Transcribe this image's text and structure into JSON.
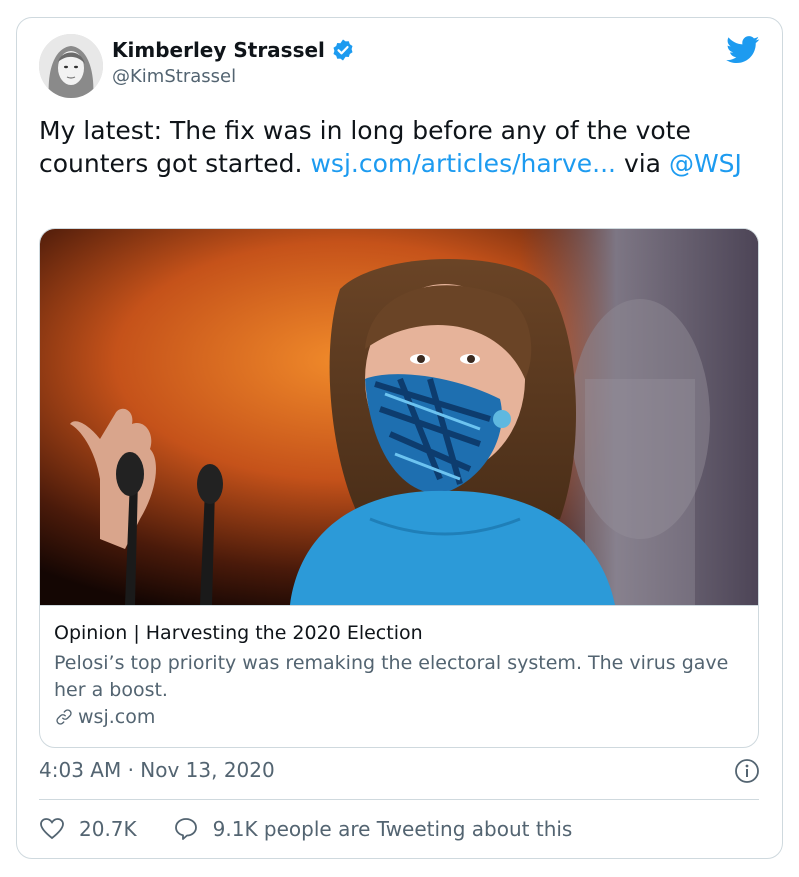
{
  "author": {
    "display_name": "Kimberley Strassel",
    "handle": "@KimStrassel",
    "verified_icon": "verified-badge-icon",
    "avatar_icon": "avatar"
  },
  "tweet": {
    "text_before_link": "My latest: The fix was in long before any of the vote counters got started.",
    "link_text": "wsj.com/articles/harve...",
    "via_text": "via",
    "mention_text": "@WSJ"
  },
  "card": {
    "title": "Opinion | Harvesting the 2020 Election",
    "description": "Pelosi’s top priority was remaking the electoral system. The virus gave her a boost.",
    "domain": "wsj.com"
  },
  "meta": {
    "timestamp": "4:03 AM · Nov 13, 2020"
  },
  "actions": {
    "likes": "20.7K",
    "conversation": "9.1K people are Tweeting about this"
  },
  "colors": {
    "link": "#1d9bf0",
    "secondary_text": "#536471",
    "border": "#cfd9de",
    "twitter_blue": "#1d9bf0"
  }
}
